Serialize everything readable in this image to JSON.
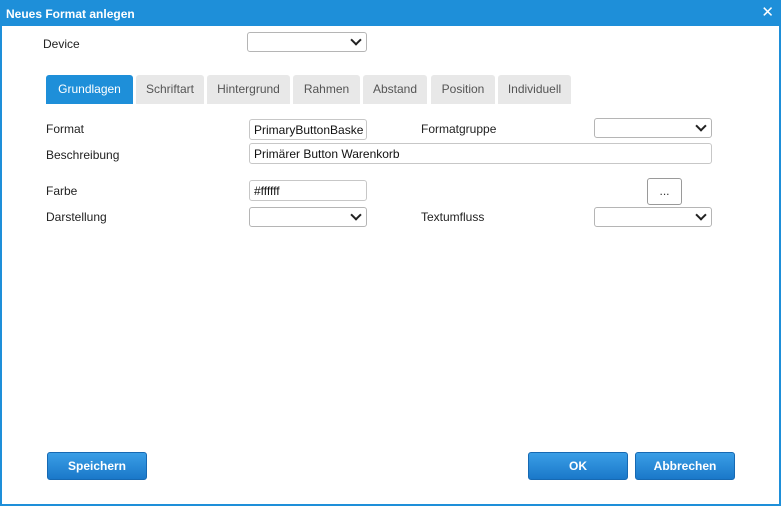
{
  "window": {
    "title": "Neues Format anlegen",
    "close_glyph": "✕"
  },
  "device": {
    "label": "Device",
    "value": ""
  },
  "tabs": [
    {
      "label": "Grundlagen",
      "active": true
    },
    {
      "label": "Schriftart",
      "active": false
    },
    {
      "label": "Hintergrund",
      "active": false
    },
    {
      "label": "Rahmen",
      "active": false
    },
    {
      "label": "Abstand",
      "active": false
    },
    {
      "label": "Position",
      "active": false
    },
    {
      "label": "Individuell",
      "active": false
    }
  ],
  "form": {
    "format": {
      "label": "Format",
      "value": "PrimaryButtonBaske"
    },
    "formatgruppe": {
      "label": "Formatgruppe",
      "value": ""
    },
    "beschreibung": {
      "label": "Beschreibung",
      "value": "Primärer Button Warenkorb"
    },
    "farbe": {
      "label": "Farbe",
      "value": "#ffffff"
    },
    "color_picker": {
      "label": "..."
    },
    "darstellung": {
      "label": "Darstellung",
      "value": ""
    },
    "textumfluss": {
      "label": "Textumfluss",
      "value": ""
    }
  },
  "buttons": {
    "save": "Speichern",
    "ok": "OK",
    "cancel": "Abbrechen"
  },
  "colors": {
    "accent": "#1e8fd9",
    "tab_inactive": "#e8e8e8"
  }
}
